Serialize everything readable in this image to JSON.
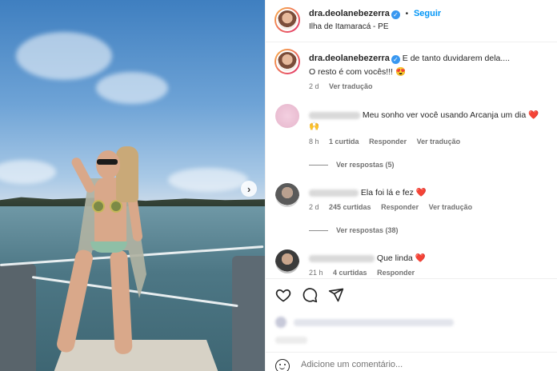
{
  "post": {
    "username": "dra.deolanebezerra",
    "verified_mark": "✓",
    "follow_label": "Seguir",
    "separator": "•",
    "location": "Ilha de Itamaracá - PE",
    "caption_line1": "E de tanto duvidarem dela....",
    "caption_line2": "O resto é com vocês!!! 😍",
    "caption_age": "2 d",
    "caption_translate": "Ver tradução"
  },
  "comments": [
    {
      "text": "Meu sonho ver você usando Arcanja um dia ❤️",
      "text_cont": "🙌",
      "age": "8 h",
      "likes": "1 curtida",
      "reply": "Responder",
      "translate": "Ver tradução",
      "view_replies": "Ver respostas (5)"
    },
    {
      "text": "Ela foi lá e fez ❤️",
      "age": "2 d",
      "likes": "245 curtidas",
      "reply": "Responder",
      "translate": "Ver tradução",
      "view_replies": "Ver respostas (38)"
    },
    {
      "text": "Que linda ❤️",
      "age": "21 h",
      "likes": "4 curtidas",
      "reply": "Responder"
    }
  ],
  "actions": {
    "icons": [
      "heart-icon",
      "comment-icon",
      "share-icon"
    ]
  },
  "add_comment": {
    "placeholder": "Adicione um comentário..."
  },
  "carousel": {
    "next_glyph": "›"
  },
  "colors": {
    "accent": "#0095f6",
    "verified": "#3897f0",
    "heart": "#ed4956"
  }
}
